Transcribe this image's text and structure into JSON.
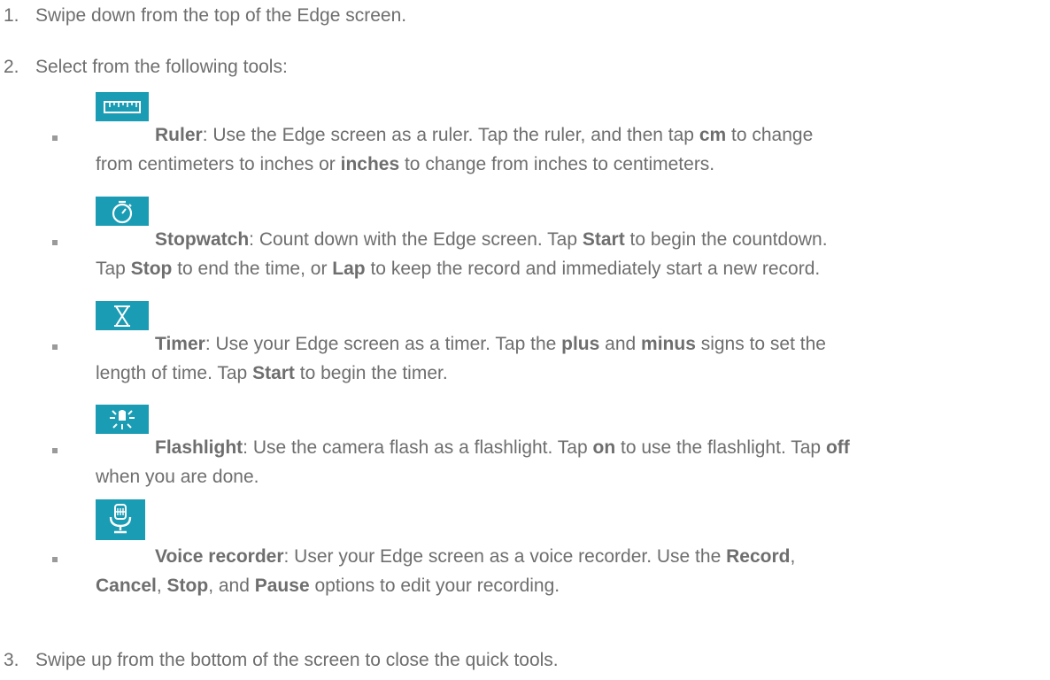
{
  "steps": [
    {
      "number": "1.",
      "text": "Swipe down from the top of the Edge screen."
    },
    {
      "number": "2.",
      "text": "Select from the following tools:"
    },
    {
      "number": "3.",
      "text": "Swipe up from the bottom of the screen to close the quick tools."
    }
  ],
  "tools": {
    "ruler": {
      "icon": "ruler-icon",
      "name": "Ruler",
      "l1a": ": Use the Edge screen as a ruler. Tap the ruler, and then tap ",
      "b1": "cm",
      "l1b": " to change",
      "l2a": "from centimeters to inches or ",
      "b2": "inches",
      "l2b": " to change from inches to centimeters."
    },
    "stopwatch": {
      "icon": "stopwatch-icon",
      "name": "Stopwatch",
      "l1a": ": Count down with the Edge screen. Tap ",
      "b1": "Start",
      "l1b": " to begin the countdown.",
      "l2a": "Tap ",
      "b2": "Stop",
      "l2b": " to end the time, or ",
      "b3": "Lap",
      "l2c": " to keep the record and immediately start a new record."
    },
    "timer": {
      "icon": "hourglass-icon",
      "name": "Timer",
      "l1a": ": Use your Edge screen as a timer. Tap the ",
      "b1": "plus",
      "l1b": " and ",
      "b2": "minus",
      "l1c": " signs to set the",
      "l2a": "length of time. Tap ",
      "b3": "Start",
      "l2b": " to begin the timer."
    },
    "flashlight": {
      "icon": "flashlight-icon",
      "name": "Flashlight",
      "l1a": ": Use the camera flash as a flashlight. Tap ",
      "b1": "on",
      "l1b": " to use the flashlight. Tap ",
      "b2": "off",
      "l2a": "when you are done."
    },
    "voice": {
      "icon": "microphone-icon",
      "name": "Voice recorder",
      "l1a": ": User your Edge screen as a voice recorder. Use the ",
      "b1": "Record",
      "l1b": ",",
      "b2": "Cancel",
      "l2a": ", ",
      "b3": "Stop",
      "l2b": ", and ",
      "b4": "Pause",
      "l2c": " options to edit your recording."
    }
  },
  "colors": {
    "icon_bg": "#1a9cb5",
    "text": "#6e6e6e",
    "bullet": "#9a9a9a"
  }
}
